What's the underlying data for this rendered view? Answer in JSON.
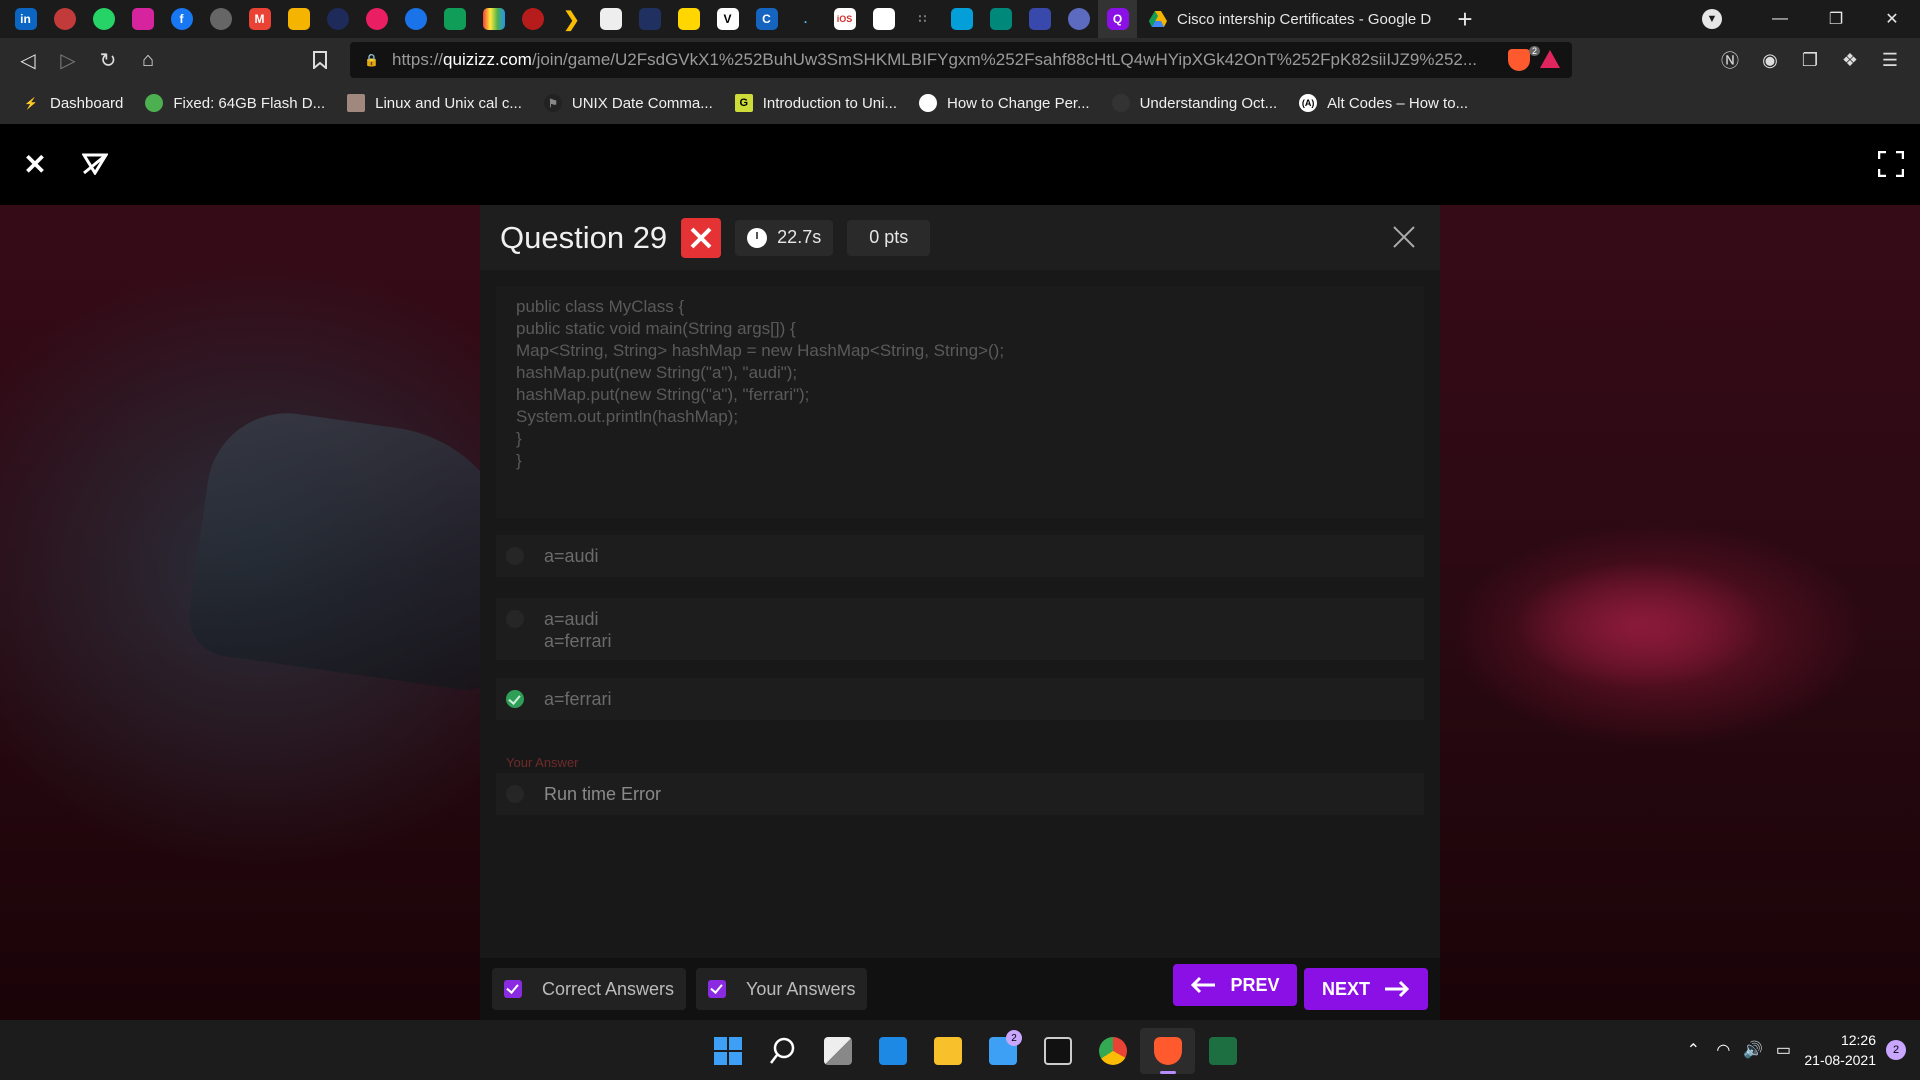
{
  "browser": {
    "active_tab_title": "Cisco intership Certificates - Google D",
    "url_prefix": "https://",
    "url_host": "quizizz.com",
    "url_path": "/join/game/U2FsdGVkX1%252BuhUw3SmSHKMLBIFYgxm%252Fsahf88cHtLQ4wHYipXGk42OnT%252FpK82siiIJZ9%252...",
    "shields_count": "2",
    "bookmarks": [
      {
        "label": "Dashboard"
      },
      {
        "label": "Fixed: 64GB Flash D..."
      },
      {
        "label": "Linux and Unix cal c..."
      },
      {
        "label": "UNIX Date Comma..."
      },
      {
        "label": "Introduction to Uni..."
      },
      {
        "label": "How to Change Per..."
      },
      {
        "label": "Understanding Oct..."
      },
      {
        "label": "Alt Codes – How to..."
      }
    ]
  },
  "quiz": {
    "question_title": "Question 29",
    "time": "22.7s",
    "points": "0 pts",
    "code_lines": [
      "public class MyClass {",
      "public static void main(String args[]) {",
      "Map<String, String> hashMap = new HashMap<String, String>();",
      "hashMap.put(new String(\"a\"), \"audi\");",
      "hashMap.put(new String(\"a\"), \"ferrari\");",
      "System.out.println(hashMap);",
      "}",
      "}"
    ],
    "options": [
      {
        "lines": [
          "a=audi"
        ],
        "correct": false
      },
      {
        "lines": [
          "a=audi",
          "a=ferrari"
        ],
        "correct": true
      },
      {
        "lines": [
          "a=ferrari"
        ],
        "correct": true
      },
      {
        "lines": [
          "Run time Error"
        ],
        "correct": false
      }
    ],
    "your_answer_label": "Your Answer",
    "filter_correct": "Correct Answers",
    "filter_yours": "Your Answers",
    "prev_label": "PREV",
    "next_label": "NEXT"
  },
  "taskbar": {
    "mail_badge": "2",
    "time": "12:26",
    "date": "21-08-2021",
    "notifications": "2"
  },
  "colors": {
    "accent_purple": "#8b10e6",
    "wrong_red": "#e53335",
    "correct_green": "#2f9e57"
  }
}
